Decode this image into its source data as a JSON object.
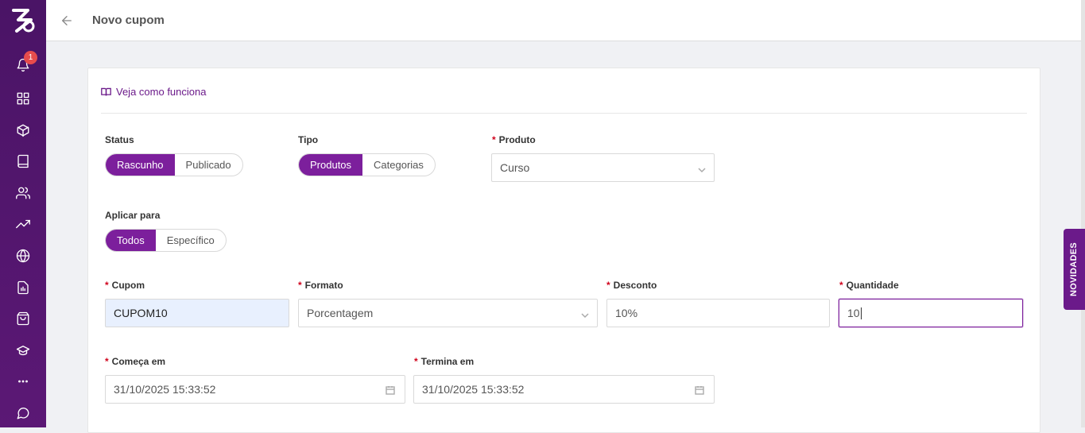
{
  "header": {
    "title": "Novo cupom"
  },
  "sidebar": {
    "notification_count": "1"
  },
  "help_link": {
    "label": "Veja como funciona"
  },
  "status": {
    "label": "Status",
    "options": [
      "Rascunho",
      "Publicado"
    ],
    "selected": "Rascunho"
  },
  "tipo": {
    "label": "Tipo",
    "options": [
      "Produtos",
      "Categorias"
    ],
    "selected": "Produtos"
  },
  "produto": {
    "label": "Produto",
    "required": true,
    "value": "Curso"
  },
  "aplicar": {
    "label": "Aplicar para",
    "options": [
      "Todos",
      "Específico"
    ],
    "selected": "Todos"
  },
  "cupom": {
    "label": "Cupom",
    "required": true,
    "value": "CUPOM10"
  },
  "formato": {
    "label": "Formato",
    "required": true,
    "value": "Porcentagem"
  },
  "desconto": {
    "label": "Desconto",
    "required": true,
    "value": "10%"
  },
  "quantidade": {
    "label": "Quantidade",
    "required": true,
    "value": "10"
  },
  "comeca": {
    "label": "Começa em",
    "required": true,
    "value": "31/10/2025 15:33:52"
  },
  "termina": {
    "label": "Termina em",
    "required": true,
    "value": "31/10/2025 15:33:52"
  },
  "novidades": {
    "label": "NOVIDADES"
  },
  "colors": {
    "accent": "#7c1f9c",
    "sidebar": "#4a1466",
    "required": "#d0021b"
  }
}
